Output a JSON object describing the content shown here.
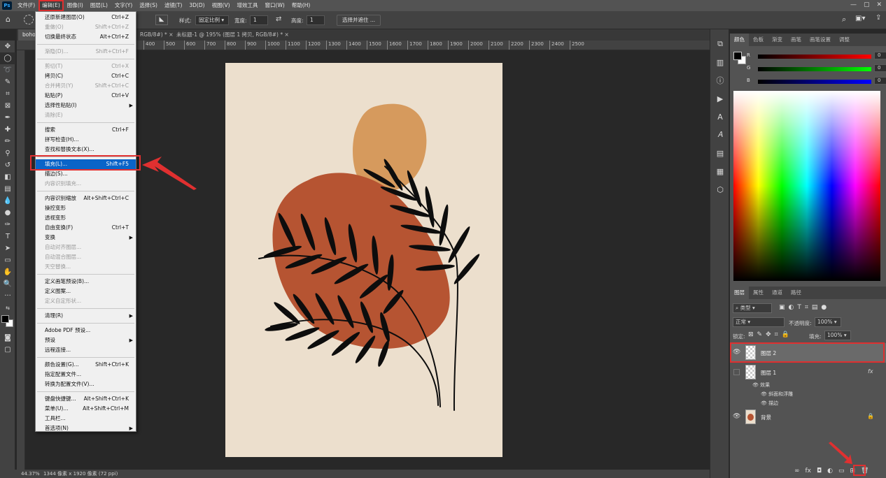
{
  "menubar": {
    "logo": "Ps",
    "items": [
      "文件(F)",
      "编辑(E)",
      "图像(I)",
      "图层(L)",
      "文字(Y)",
      "选择(S)",
      "滤镜(T)",
      "3D(D)",
      "视图(V)",
      "增效工具",
      "窗口(W)",
      "帮助(H)"
    ],
    "active_index": 1
  },
  "optionsbar": {
    "style_label": "样式:",
    "style_value": "固定比例",
    "width_label": "宽度:",
    "width_value": "1",
    "height_label": "高度:",
    "height_value": "1",
    "select_mask": "选择并遮住 ..."
  },
  "tabs": [
    {
      "label": "boho"
    },
    {
      "label": "RGB/8#) *"
    },
    {
      "label": "未标题-1 @ 195% (图层 1 拷贝, RGB/8#) *"
    }
  ],
  "ruler_ticks": [
    "400",
    "500",
    "600",
    "700",
    "800",
    "900",
    "1000",
    "1100",
    "1200",
    "1300",
    "1400",
    "1500",
    "1600",
    "1700",
    "1800",
    "1900",
    "2000",
    "2100",
    "2200",
    "2300",
    "2400",
    "2500"
  ],
  "edit_menu": [
    {
      "label": "还原新建图层(O)",
      "shortcut": "Ctrl+Z",
      "enabled": true
    },
    {
      "label": "重做(O)",
      "shortcut": "Shift+Ctrl+Z",
      "enabled": false
    },
    {
      "label": "切换最终状态",
      "shortcut": "Alt+Ctrl+Z",
      "enabled": true
    },
    {
      "sep": true
    },
    {
      "label": "渐隐(D)...",
      "shortcut": "Shift+Ctrl+F",
      "enabled": false
    },
    {
      "sep": true
    },
    {
      "label": "剪切(T)",
      "shortcut": "Ctrl+X",
      "enabled": false
    },
    {
      "label": "拷贝(C)",
      "shortcut": "Ctrl+C",
      "enabled": true
    },
    {
      "label": "合并拷贝(Y)",
      "shortcut": "Shift+Ctrl+C",
      "enabled": false
    },
    {
      "label": "粘贴(P)",
      "shortcut": "Ctrl+V",
      "enabled": true
    },
    {
      "label": "选择性粘贴(I)",
      "shortcut": "",
      "enabled": true,
      "submenu": true
    },
    {
      "label": "清除(E)",
      "shortcut": "",
      "enabled": false
    },
    {
      "sep": true
    },
    {
      "label": "搜索",
      "shortcut": "Ctrl+F",
      "enabled": true
    },
    {
      "label": "拼写检查(H)...",
      "shortcut": "",
      "enabled": true
    },
    {
      "label": "查找和替换文本(X)...",
      "shortcut": "",
      "enabled": true
    },
    {
      "sep": true
    },
    {
      "label": "填充(L)...",
      "shortcut": "Shift+F5",
      "enabled": true,
      "highlighted": true
    },
    {
      "label": "描边(S)...",
      "shortcut": "",
      "enabled": true
    },
    {
      "label": "内容识别填充...",
      "shortcut": "",
      "enabled": false
    },
    {
      "sep": true
    },
    {
      "label": "内容识别缩放",
      "shortcut": "Alt+Shift+Ctrl+C",
      "enabled": true
    },
    {
      "label": "操控变形",
      "shortcut": "",
      "enabled": true
    },
    {
      "label": "透视变形",
      "shortcut": "",
      "enabled": true
    },
    {
      "label": "自由变换(F)",
      "shortcut": "Ctrl+T",
      "enabled": true
    },
    {
      "label": "变换",
      "shortcut": "",
      "enabled": true,
      "submenu": true
    },
    {
      "label": "自动对齐图层...",
      "shortcut": "",
      "enabled": false
    },
    {
      "label": "自动混合图层...",
      "shortcut": "",
      "enabled": false
    },
    {
      "label": "天空替换...",
      "shortcut": "",
      "enabled": false
    },
    {
      "sep": true
    },
    {
      "label": "定义画笔预设(B)...",
      "shortcut": "",
      "enabled": true
    },
    {
      "label": "定义图案...",
      "shortcut": "",
      "enabled": true
    },
    {
      "label": "定义自定形状...",
      "shortcut": "",
      "enabled": false
    },
    {
      "sep": true
    },
    {
      "label": "清理(R)",
      "shortcut": "",
      "enabled": true,
      "submenu": true
    },
    {
      "sep": true
    },
    {
      "label": "Adobe PDF 预设...",
      "shortcut": "",
      "enabled": true
    },
    {
      "label": "预设",
      "shortcut": "",
      "enabled": true,
      "submenu": true
    },
    {
      "label": "远程连接...",
      "shortcut": "",
      "enabled": true
    },
    {
      "sep": true
    },
    {
      "label": "颜色设置(G)...",
      "shortcut": "Shift+Ctrl+K",
      "enabled": true
    },
    {
      "label": "指定配置文件...",
      "shortcut": "",
      "enabled": true
    },
    {
      "label": "转换为配置文件(V)...",
      "shortcut": "",
      "enabled": true
    },
    {
      "sep": true
    },
    {
      "label": "键盘快捷键...",
      "shortcut": "Alt+Shift+Ctrl+K",
      "enabled": true
    },
    {
      "label": "菜单(U)...",
      "shortcut": "Alt+Shift+Ctrl+M",
      "enabled": true
    },
    {
      "label": "工具栏...",
      "shortcut": "",
      "enabled": true
    },
    {
      "label": "首选项(N)",
      "shortcut": "",
      "enabled": true,
      "submenu": true
    }
  ],
  "color_panel": {
    "tabs": [
      "颜色",
      "色板",
      "渐变",
      "画笔",
      "画笔设置",
      "调整"
    ],
    "selected_tab": 0,
    "r_label": "R",
    "r_value": "0",
    "g_label": "G",
    "g_value": "0",
    "b_label": "B",
    "b_value": "0"
  },
  "layers_panel": {
    "tabs": [
      "图层",
      "属性",
      "通道",
      "路径"
    ],
    "selected_tab": 0,
    "filter_label": "类型",
    "blend_mode": "正常",
    "opacity_label": "不透明度:",
    "opacity_value": "100%",
    "lock_label": "锁定:",
    "fill_label": "填充:",
    "fill_value": "100%",
    "layers": [
      {
        "name": "图层 2",
        "visible": true,
        "selected": true
      },
      {
        "name": "图层 1",
        "visible": false,
        "selected": false,
        "fx": "fx"
      },
      {
        "name": "背景",
        "visible": true,
        "selected": false
      }
    ],
    "effects_label": "效果",
    "effect_items": [
      "斜面和浮雕",
      "描边"
    ]
  },
  "statusbar": {
    "zoom": "44.37%",
    "doc_info": "1344 像素 x 1920 像素 (72 ppi)"
  },
  "colors": {
    "artboard_bg": "#ecdfcd",
    "rust": "#b65432",
    "sand": "#d69a5d",
    "leaf": "#0d0d0d",
    "accent_red": "#e03030",
    "menu_highlight": "#0a64c8"
  }
}
